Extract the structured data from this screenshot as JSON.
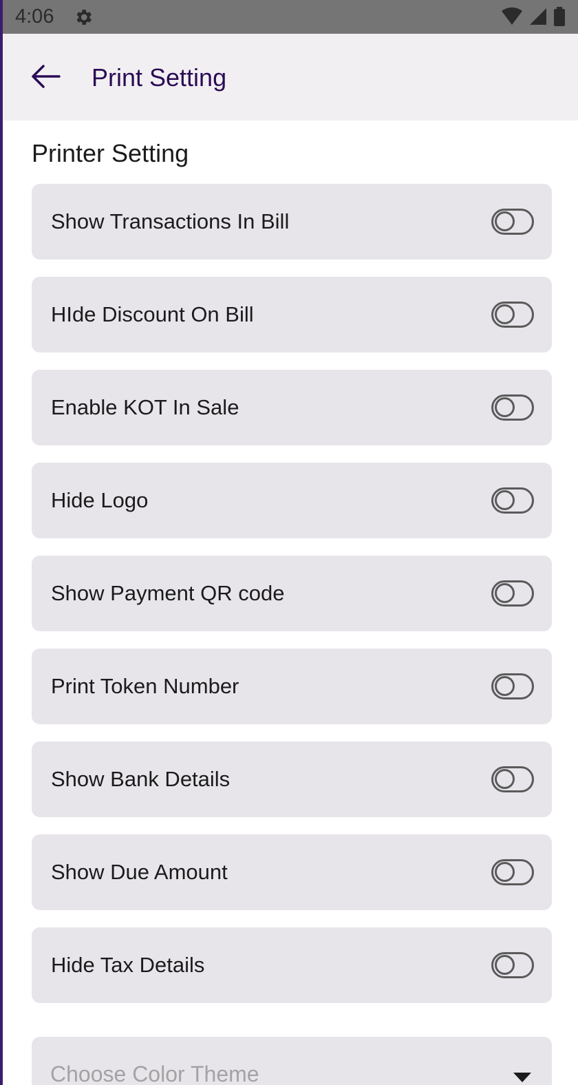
{
  "status_bar": {
    "time": "4:06",
    "icons": [
      "gear-icon",
      "wifi-icon",
      "signal-icon",
      "battery-icon"
    ]
  },
  "app_bar": {
    "title": "Print Setting",
    "back_icon": "arrow-left-icon"
  },
  "section": {
    "title": "Printer Setting"
  },
  "settings": [
    {
      "label": "Show Transactions In Bill",
      "enabled": false
    },
    {
      "label": "HIde Discount On Bill",
      "enabled": false
    },
    {
      "label": "Enable KOT In Sale",
      "enabled": false
    },
    {
      "label": "Hide Logo",
      "enabled": false
    },
    {
      "label": "Show Payment QR code",
      "enabled": false
    },
    {
      "label": "Print Token Number",
      "enabled": false
    },
    {
      "label": "Show Bank Details",
      "enabled": false
    },
    {
      "label": "Show Due Amount",
      "enabled": false
    },
    {
      "label": "Hide Tax Details",
      "enabled": false
    }
  ],
  "color_theme": {
    "placeholder": "Choose Color Theme",
    "icon": "caret-down-icon"
  },
  "colors": {
    "accent": "#2a0c55",
    "row_background": "#e7e5ea",
    "app_bar_background": "#f2eff2"
  }
}
